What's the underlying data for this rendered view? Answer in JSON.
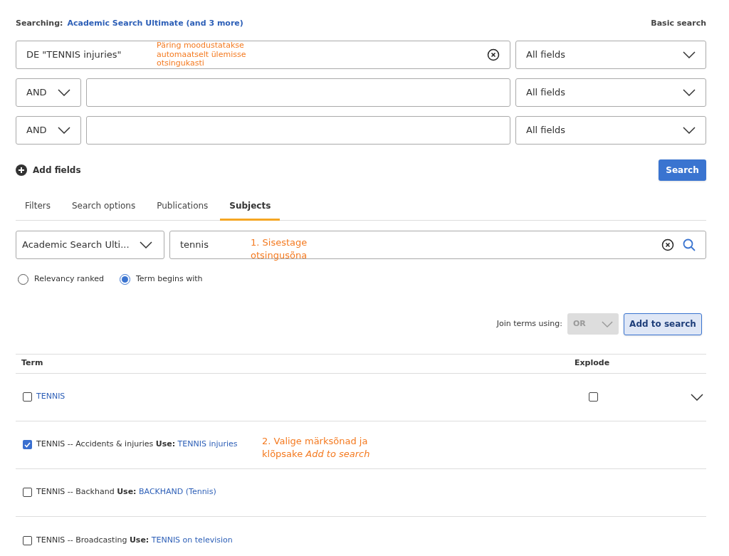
{
  "header": {
    "searching_label": "Searching:",
    "databases_link": "Academic Search Ultimate (and 3 more)",
    "basic_search_link": "Basic search"
  },
  "search_rows": [
    {
      "operator": "",
      "value": "DE \"TENNIS injuries\"",
      "field": "All fields"
    },
    {
      "operator": "AND",
      "value": "",
      "field": "All fields"
    },
    {
      "operator": "AND",
      "value": "",
      "field": "All fields"
    }
  ],
  "add_fields": "Add fields",
  "search_button": "Search",
  "tabs": [
    {
      "label": "Filters",
      "selected": false
    },
    {
      "label": "Search options",
      "selected": false
    },
    {
      "label": "Publications",
      "selected": false
    },
    {
      "label": "Subjects",
      "selected": true
    }
  ],
  "subject_search": {
    "database": "Academic Search Ulti...",
    "value": "tennis"
  },
  "radios": [
    {
      "label": "Relevancy ranked",
      "selected": false
    },
    {
      "label": "Term begins with",
      "selected": true
    }
  ],
  "join": {
    "label": "Join terms using:",
    "operator": "OR",
    "button": "Add to search"
  },
  "table": {
    "columns": [
      "Term",
      "Explode"
    ],
    "rows": [
      {
        "kind": "term",
        "checked": false,
        "term": "TENNIS",
        "explode_checked": false
      },
      {
        "kind": "use",
        "checked": true,
        "term": "TENNIS -- Accidents & injuries **Use:**",
        "link": "TENNIS injuries"
      },
      {
        "kind": "use",
        "checked": false,
        "term": "TENNIS -- Backhand **Use:**",
        "link": "BACKHAND (Tennis)"
      },
      {
        "kind": "use",
        "checked": false,
        "term": "TENNIS -- Broadcasting **Use:**",
        "link": "TENNIS on television"
      }
    ]
  },
  "annotations": [
    {
      "lines": [
        "Päring moodustatakse",
        "automaatselt ülemisse",
        "otsingukasti"
      ]
    },
    {
      "lines": [
        "1. Sisestage",
        "otsingusõna"
      ]
    },
    {
      "lines": [
        "2. Valige märksõnad ja",
        "klõpsake *Add to search*"
      ]
    }
  ]
}
